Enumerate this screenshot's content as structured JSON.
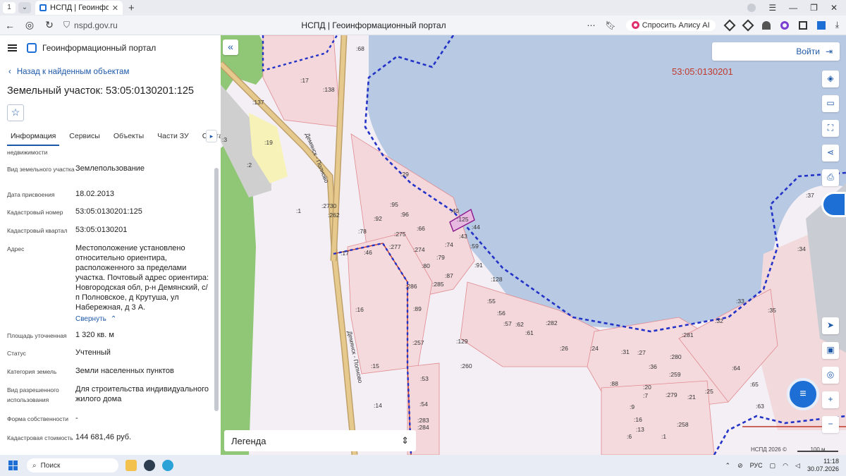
{
  "browser": {
    "tab_count": "1",
    "tab_title": "НСПД | Геоинформационный портал",
    "url": "nspd.gov.ru",
    "page_title": "НСПД | Геоинформационный портал",
    "alisa": "Спросить Алису AI"
  },
  "app": {
    "title": "Геоинформационный портал",
    "back": "Назад к найденным объектам",
    "object_title": "Земельный участок: 53:05:0130201:125"
  },
  "tabs": [
    "Информация",
    "Сервисы",
    "Объекты",
    "Части ЗУ",
    "Состав"
  ],
  "info": [
    {
      "label": "недвижимости",
      "value": ""
    },
    {
      "label": "Вид земельного участка",
      "value": "Землепользование"
    },
    {
      "label": "Дата присвоения",
      "value": "18.02.2013"
    },
    {
      "label": "Кадастровый номер",
      "value": "53:05:0130201:125"
    },
    {
      "label": "Кадастровый квартал",
      "value": "53:05:0130201"
    },
    {
      "label": "Адрес",
      "value": "Местоположение установлено относительно ориентира, расположенного за пределами участка. Почтовый адрес ориентира: Новгородская обл, р-н Демянский, с/п Полновское, д Крутуша, ул Набережная, д 3 А."
    },
    {
      "label": "Площадь уточненная",
      "value": "1 320 кв. м"
    },
    {
      "label": "Статус",
      "value": "Учтенный"
    },
    {
      "label": "Категория земель",
      "value": "Земли населенных пунктов"
    },
    {
      "label": "Вид разрешенного использования",
      "value": "Для строительства индивидуального жилого дома"
    },
    {
      "label": "Форма собственности",
      "value": "-"
    },
    {
      "label": "Кадастровая стоимость",
      "value": "144 681,46 руб."
    }
  ],
  "collapse_label": "Свернуть",
  "map": {
    "login": "Войти",
    "quarter": "53:05:0130201",
    "legend": "Легенда",
    "copyright": "НСПД 2026 ©",
    "scale": "100 м",
    "road_label": "Демянск - Полново",
    "labels": [
      ":68",
      ":17",
      ":138",
      ":137",
      ":19",
      ":2",
      ":3",
      ":29",
      ":2730",
      ":262",
      ":1",
      ":95",
      ":96",
      ":92",
      ":40",
      ":125",
      ":44",
      ":78",
      ":275",
      ":66",
      ":43",
      ":59",
      ":17",
      ":46",
      ":277",
      ":274",
      ":74",
      ":79",
      ":80",
      ":91",
      ":87",
      ":285",
      ":286",
      ":128",
      ":89",
      ":55",
      ":56",
      ":57",
      ":62",
      ":61",
      ":282",
      ":16",
      ":257",
      ":129",
      ":26",
      ":24",
      ":31",
      ":27",
      ":281",
      ":36",
      ":280",
      ":260",
      ":53",
      ":88",
      ":259",
      ":20",
      ":7",
      ":279",
      ":21",
      ":25",
      ":64",
      ":65",
      ":63",
      ":54",
      ":283",
      ":284",
      ":9",
      ":16",
      ":13",
      ":6",
      ":1",
      ":258",
      ":15",
      ":14",
      ":13",
      ":33",
      ":35",
      ":32",
      ":34",
      ":37"
    ]
  },
  "taskbar": {
    "search": "Поиск",
    "lang": "РУС",
    "time": "11:18",
    "date": "30.07.2026"
  }
}
